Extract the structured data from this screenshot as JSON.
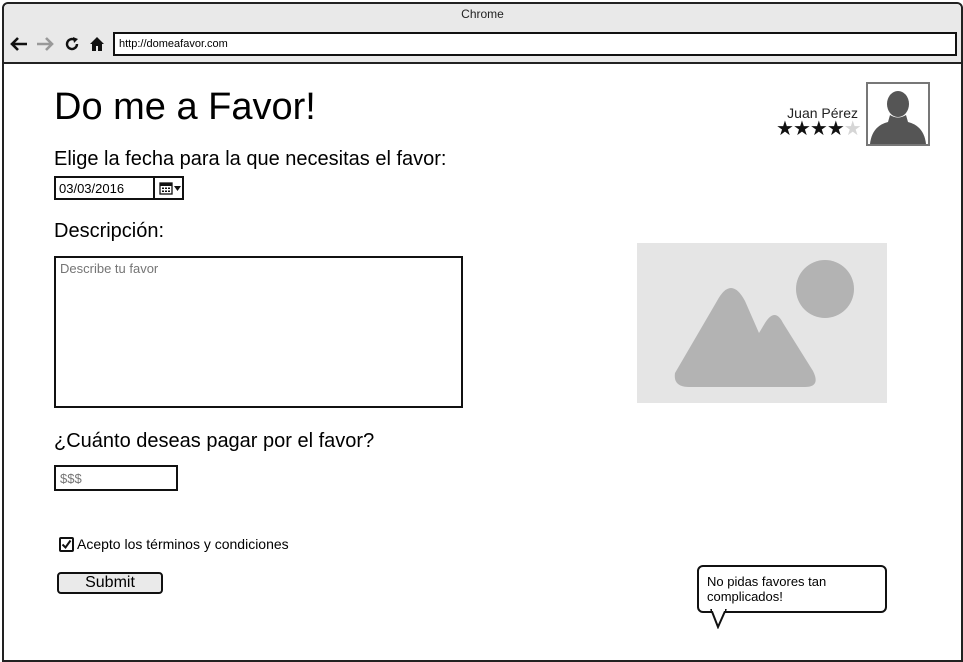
{
  "browser": {
    "title": "Chrome",
    "url": "http://domeafavor.com",
    "icons": [
      "back-arrow-icon",
      "forward-arrow-icon",
      "reload-icon",
      "home-icon"
    ]
  },
  "page": {
    "heading": "Do me a Favor!",
    "date_label": "Elige la fecha para la que necesitas el favor:",
    "date_value": "03/03/2016",
    "description_label": "Descripción:",
    "description_placeholder": "Describe tu favor",
    "price_label": "¿Cuánto deseas pagar por el favor?",
    "price_placeholder": "$$$",
    "terms_label": "Acepto los términos y condiciones",
    "terms_checked": true,
    "submit_label": "Submit"
  },
  "user": {
    "name": "Juan Pérez",
    "rating": 4,
    "rating_max": 5
  },
  "tooltip": {
    "text": "No pidas favores tan complicados!"
  },
  "colors": {
    "border": "#111111",
    "titlebar": "#e9e9e9",
    "placeholder_bg": "#e5e5e5",
    "placeholder_shape": "#b3b3b3",
    "avatar_silhouette": "#555555"
  }
}
